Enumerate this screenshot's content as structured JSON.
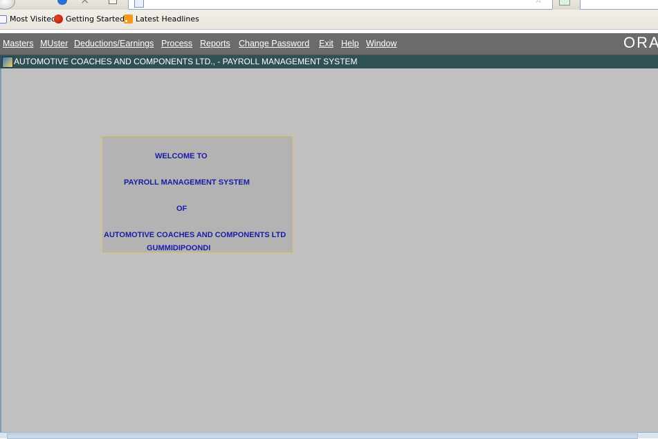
{
  "bookmarks": [
    {
      "label": "Most Visited",
      "icon": "folder-icon"
    },
    {
      "label": "Getting Started",
      "icon": "firefox-icon"
    },
    {
      "label": "Latest Headlines",
      "icon": "rss-icon"
    }
  ],
  "menu": [
    {
      "label": "Masters"
    },
    {
      "label": "MUster"
    },
    {
      "label": "Deductions/Earnings"
    },
    {
      "label": "Process"
    },
    {
      "label": "Reports"
    },
    {
      "label": "Change Password"
    },
    {
      "label": "Exit"
    },
    {
      "label": "Help"
    },
    {
      "label": "Window"
    }
  ],
  "logo_text": "ORA",
  "window_title": "AUTOMOTIVE COACHES AND COMPONENTS LTD., - PAYROLL MANAGEMENT SYSTEM",
  "welcome": {
    "line1": "WELCOME TO",
    "line2": "PAYROLL MANAGEMENT SYSTEM",
    "line3": "OF",
    "line4": "AUTOMOTIVE COACHES AND COMPONENTS LTD",
    "line5": "GUMMIDIPOONDI"
  },
  "colors": {
    "menubar": "#6b6b6b",
    "titlebar": "#2f5155",
    "canvas": "#c0c0c0",
    "welcome_text": "#1a1aa8",
    "welcome_border": "#e2c25a"
  }
}
